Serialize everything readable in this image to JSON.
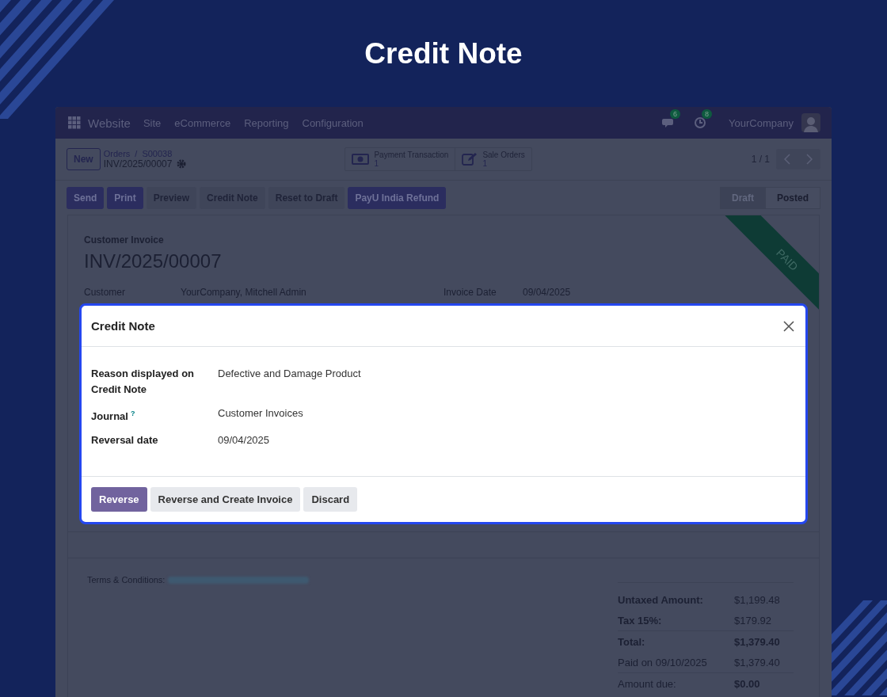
{
  "page_title": "Credit Note",
  "navbar": {
    "app": "Website",
    "menu": [
      "Site",
      "eCommerce",
      "Reporting",
      "Configuration"
    ],
    "messages_count": "6",
    "activities_count": "8",
    "company": "YourCompany"
  },
  "control_panel": {
    "new_button": "New",
    "breadcrumb": [
      "Orders",
      "S00038"
    ],
    "separator": "/",
    "record": "INV/2025/00007",
    "smart_buttons": [
      {
        "kind": "money",
        "label": "Payment Transaction",
        "value": "1"
      },
      {
        "kind": "edit",
        "label": "Sale Orders",
        "value": "1"
      }
    ],
    "pager": "1 / 1"
  },
  "actions": [
    {
      "kind": "primary",
      "label": "Send"
    },
    {
      "kind": "primary",
      "label": "Print"
    },
    {
      "kind": "secondary",
      "label": "Preview"
    },
    {
      "kind": "secondary",
      "label": "Credit Note"
    },
    {
      "kind": "secondary",
      "label": "Reset to Draft"
    },
    {
      "kind": "primary",
      "label": "PayU India Refund"
    }
  ],
  "statusbar": [
    {
      "label": "Draft",
      "selected": false
    },
    {
      "label": "Posted",
      "selected": true
    }
  ],
  "form": {
    "type": "Customer Invoice",
    "name": "INV/2025/00007",
    "ribbon": "PAID",
    "fields": [
      {
        "label": "Customer",
        "value": "YourCompany, Mitchell Admin"
      },
      {
        "label": "Invoice Date",
        "value": "09/04/2025"
      }
    ],
    "terms_label": "Terms & Conditions:",
    "totals": [
      {
        "kind": "subtotal",
        "label": "Untaxed Amount:",
        "value": "$1,199.48"
      },
      {
        "kind": "subtotal",
        "label": "Tax 15%:",
        "value": "$179.92"
      },
      {
        "kind": "total",
        "label": "Total:",
        "value": "$1,379.40"
      },
      {
        "kind": "payment",
        "label": "Paid on 09/10/2025",
        "value": "$1,379.40"
      },
      {
        "kind": "due",
        "label": "Amount due:",
        "value": "$0.00"
      }
    ]
  },
  "dialog": {
    "title": "Credit Note",
    "fields": [
      {
        "label": "Reason displayed on Credit Note",
        "value": "Defective and Damage Product"
      },
      {
        "label": "Journal",
        "help": "?",
        "value": "Customer Invoices"
      },
      {
        "label": "Reversal date",
        "value": "09/04/2025"
      }
    ],
    "buttons": [
      {
        "kind": "primary",
        "label": "Reverse"
      },
      {
        "kind": "secondary",
        "label": "Reverse and Create Invoice"
      },
      {
        "kind": "secondary",
        "label": "Discard"
      }
    ]
  }
}
